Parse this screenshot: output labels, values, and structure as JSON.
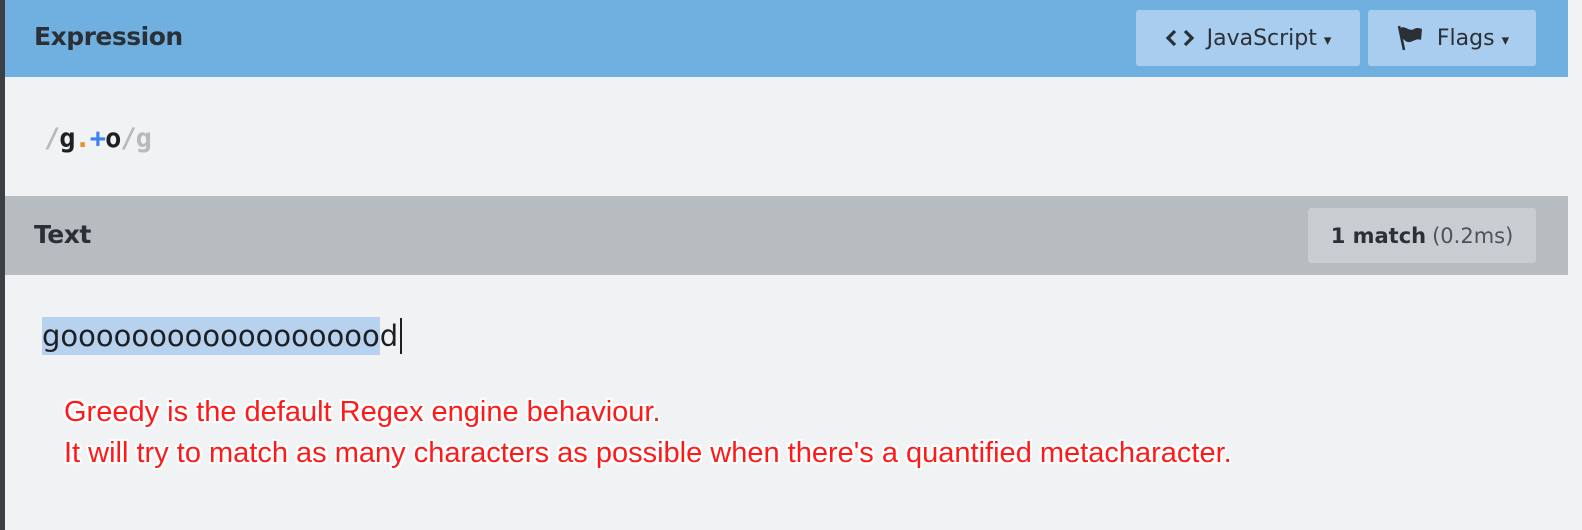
{
  "expression_header": {
    "title": "Expression",
    "language_button": "JavaScript",
    "language_caret": "▾",
    "flags_button": "Flags",
    "flags_caret": "▾"
  },
  "expression": {
    "open_delimiter": "/",
    "token_g": "g",
    "token_dot": ".",
    "token_plus": "+",
    "token_o": "o",
    "close_delimiter": "/",
    "flags": "g"
  },
  "text_header": {
    "title": "Text",
    "match_count": "1 match",
    "match_time": "(0.2ms)"
  },
  "test_text": {
    "matched": "goooooooooooooooooo",
    "rest": "d"
  },
  "annotation": {
    "line1": "Greedy is the default Regex engine behaviour.",
    "line2": "It will try to match as many characters as possible when there's a quantified metacharacter."
  },
  "colors": {
    "header_blue": "#70b0e0",
    "text_header_gray": "#b7bcc1",
    "match_highlight": "#b7d2ee",
    "annotation_red": "#ff1a1a",
    "dot_orange": "#e5902b",
    "quantifier_blue": "#3f82f0"
  },
  "icons": {
    "language": "code-brackets-icon",
    "flags": "flag-icon"
  }
}
